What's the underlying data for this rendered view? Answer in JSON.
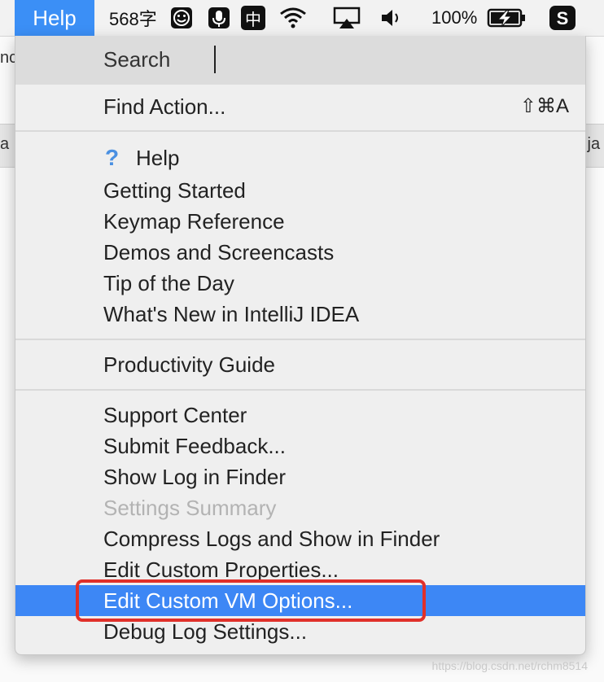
{
  "menubar": {
    "menu_title": "Help",
    "word_count": "568字",
    "ime": "中",
    "battery": "100%"
  },
  "background": {
    "frag_top_left": "nc",
    "frag_tab_left": "a",
    "frag_tab_right": ".ja"
  },
  "menu": {
    "search_label": "Search",
    "search_value": "",
    "find_action": {
      "label": "Find Action...",
      "shortcut": "⇧⌘A"
    },
    "group1": [
      "Help",
      "Getting Started",
      "Keymap Reference",
      "Demos and Screencasts",
      "Tip of the Day",
      "What's New in IntelliJ IDEA"
    ],
    "group2": [
      "Productivity Guide"
    ],
    "group3": [
      "Support Center",
      "Submit Feedback...",
      "Show Log in Finder",
      "Settings Summary",
      "Compress Logs and Show in Finder",
      "Edit Custom Properties...",
      "Edit Custom VM Options...",
      "Debug Log Settings..."
    ],
    "selected_item": "Edit Custom VM Options...",
    "disabled_item": "Settings Summary"
  },
  "watermark": "https://blog.csdn.net/rchm8514",
  "colors": {
    "accent": "#3d87f5",
    "highlight_box": "#e0302a"
  }
}
